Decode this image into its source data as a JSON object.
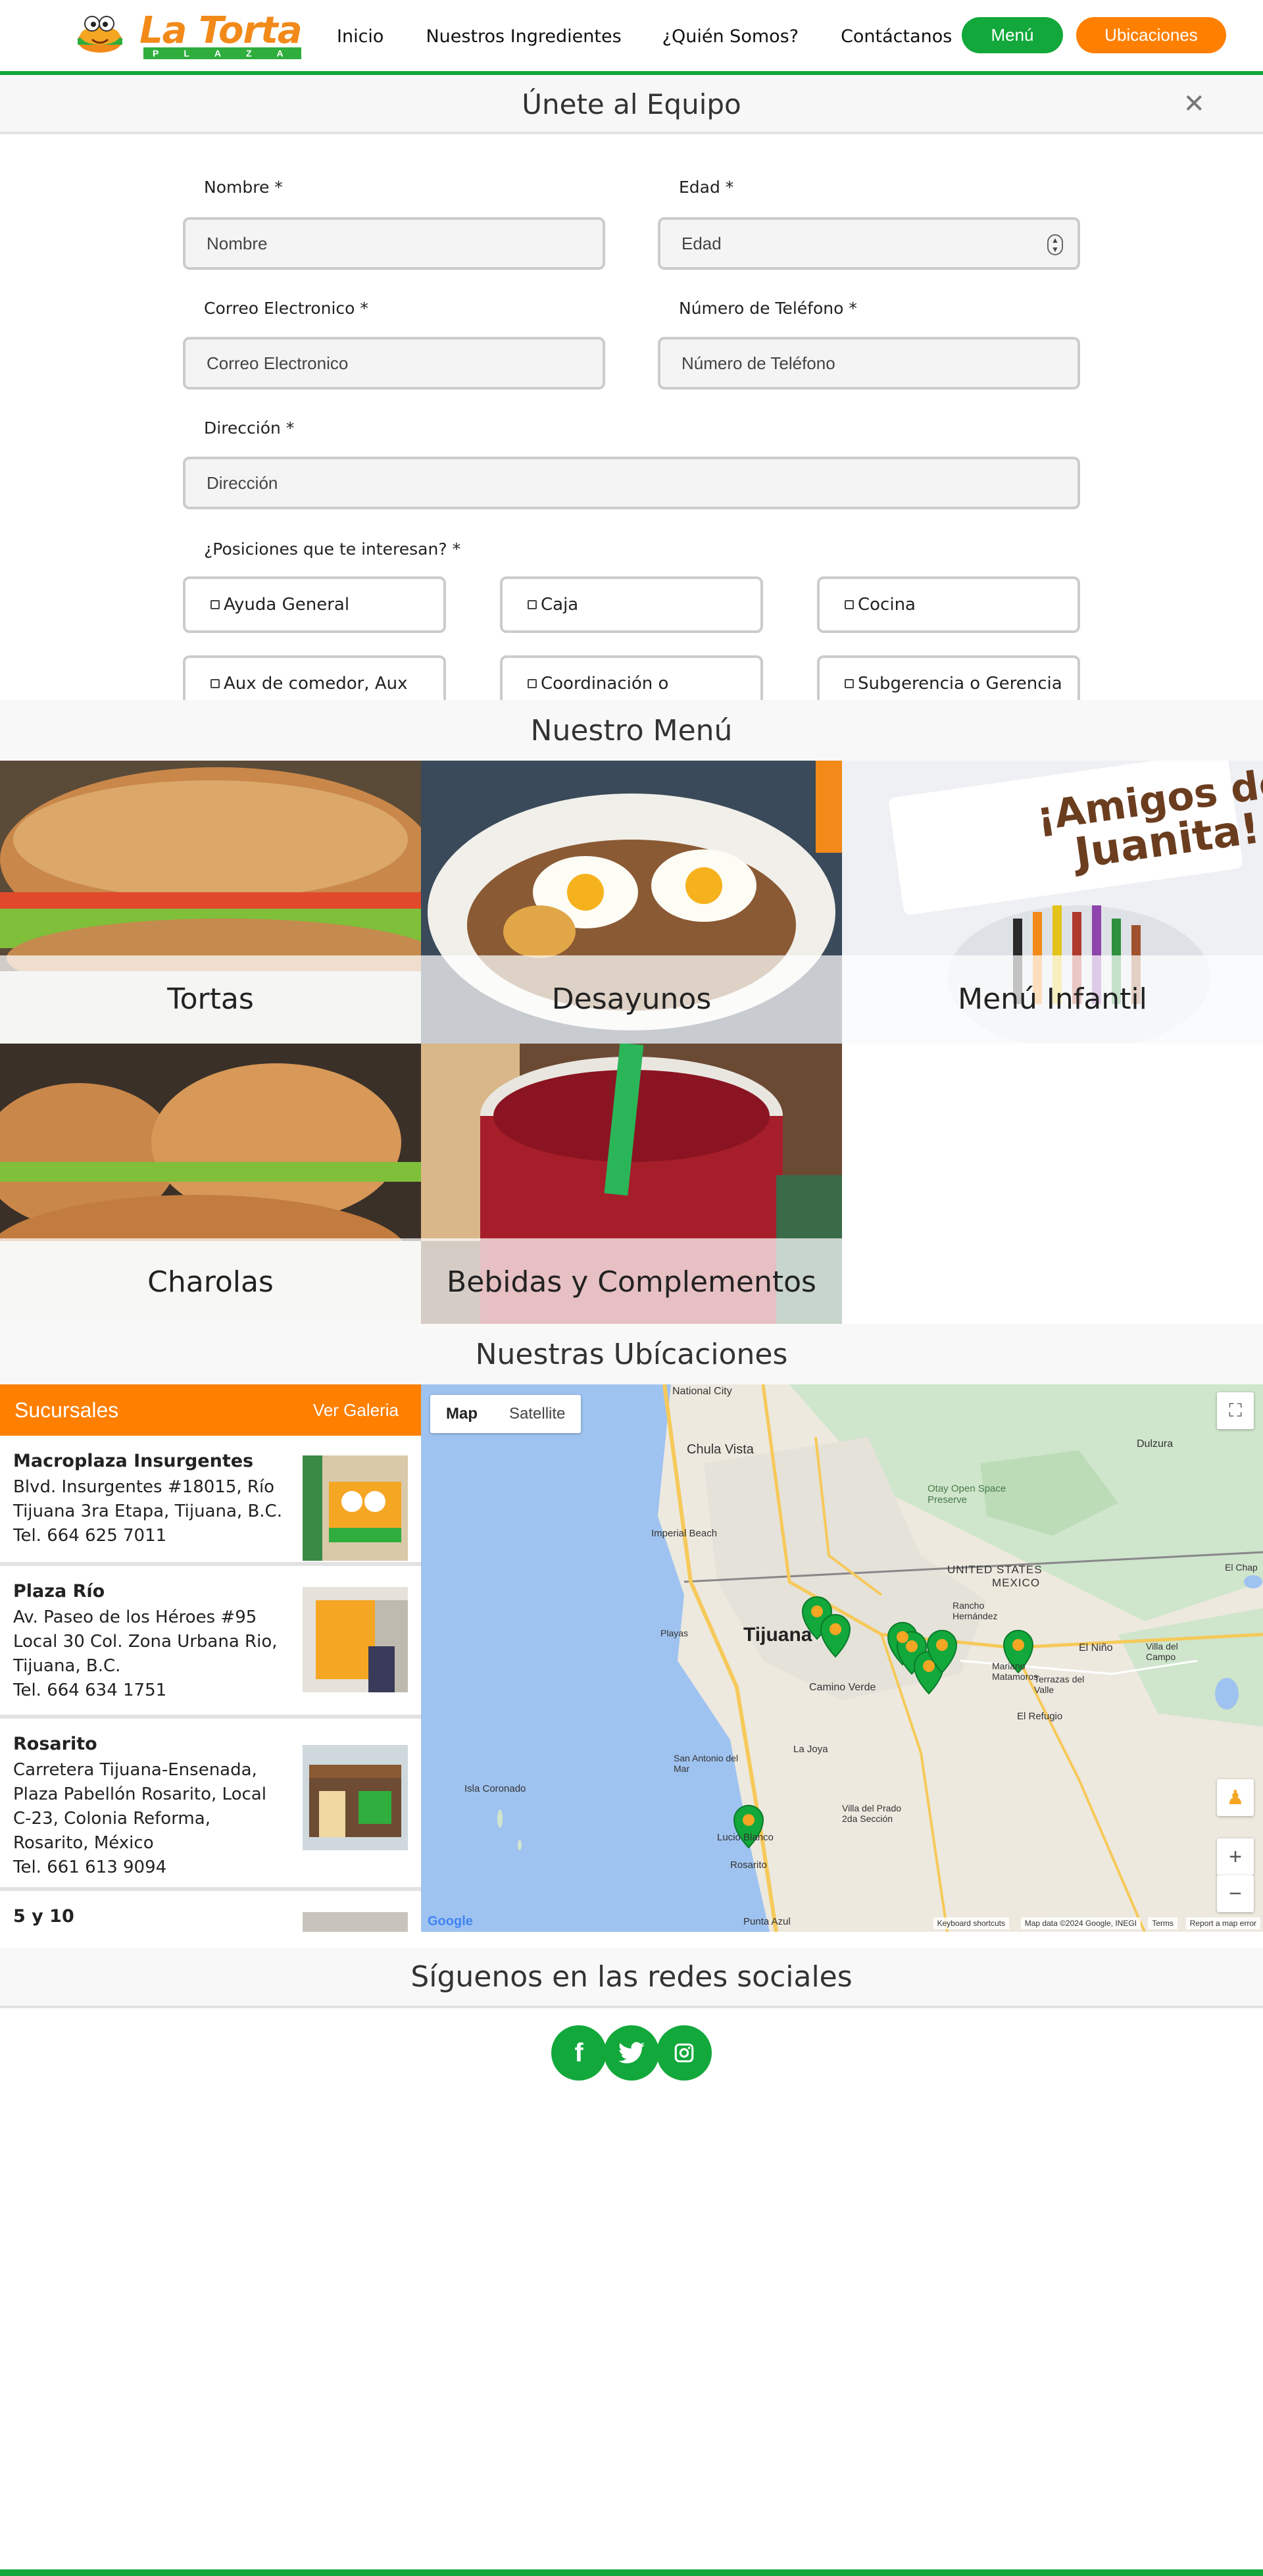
{
  "nav": {
    "logo_text": "La Torta",
    "logo_sub": "PLAZA",
    "links": [
      "Inicio",
      "Nuestros Ingredientes",
      "¿Quién Somos?",
      "Contáctanos"
    ],
    "btn_menu": "Menú",
    "btn_locations": "Ubicaciones",
    "colors": {
      "green": "#12a83b",
      "orange": "#ff7f00"
    }
  },
  "join": {
    "title": "Únete al Equipo",
    "close_icon": "close-icon",
    "fields": {
      "nombre": {
        "label": "Nombre *",
        "placeholder": "Nombre"
      },
      "edad": {
        "label": "Edad *",
        "placeholder": "Edad"
      },
      "correo": {
        "label": "Correo Electronico *",
        "placeholder": "Correo Electronico"
      },
      "telefono": {
        "label": "Número de Teléfono *",
        "placeholder": "Número de Teléfono"
      },
      "direccion": {
        "label": "Dirección *",
        "placeholder": "Dirección"
      }
    },
    "positions_label": "¿Posiciones que te interesan? *",
    "positions": [
      "Ayuda General",
      "Caja",
      "Cocina",
      "Aux de comedor, Aux",
      "Coordinación o",
      "Subgerencia o Gerencia"
    ]
  },
  "menu": {
    "title": "Nuestro Menú",
    "items": [
      "Tortas",
      "Desayunos",
      "Menú Infantil",
      "Charolas",
      "Bebidas y Complementos"
    ]
  },
  "locations": {
    "title": "Nuestras Ubícaciones",
    "sidebar_title": "Sucursales",
    "gallery_link": "Ver Galeria",
    "branches": [
      {
        "name": "Macroplaza Insurgentes",
        "address": "Blvd. Insurgentes #18015, Río Tijuana 3ra Etapa, Tijuana, B.C.",
        "phone": "Tel. 664 625 7011"
      },
      {
        "name": "Plaza Río",
        "address": "Av. Paseo de los Héroes #95 Local 30 Col. Zona Urbana Rio, Tijuana, B.C.",
        "phone": "Tel. 664 634 1751"
      },
      {
        "name": "Rosarito",
        "address": "Carretera Tijuana-Ensenada, Plaza Pabellón Rosarito, Local C-23, Colonia Reforma, Rosarito, México",
        "phone": "Tel. 661 613 9094"
      },
      {
        "name": "5 y 10",
        "address": "",
        "phone": ""
      }
    ],
    "map": {
      "type_map": "Map",
      "type_satellite": "Satellite",
      "city_label": "Tijuana",
      "labels": [
        "National City",
        "Chula Vista",
        "Imperial Beach",
        "Otay Open Space Preserve",
        "Dulzura",
        "UNITED STATES",
        "MEXICO",
        "Rancho Hernández",
        "Mariano Matamoros",
        "Terrazas del Valle",
        "El Niño",
        "Villa del Campo",
        "El Refugio",
        "La Joya",
        "San Antonio del Mar",
        "Villa del Prado 2da Sección",
        "Isla Coronado",
        "Lucio Blanco",
        "Rosarito",
        "Punta Azul",
        "Playas",
        "Camino Verde",
        "El Chap"
      ],
      "attribution": [
        "Keyboard shortcuts",
        "Map data ©2024 Google, INEGI",
        "Terms",
        "Report a map error"
      ],
      "google": "Google"
    }
  },
  "social": {
    "title": "Síguenos en las redes sociales",
    "icons": [
      "facebook-icon",
      "twitter-icon",
      "instagram-icon"
    ]
  }
}
